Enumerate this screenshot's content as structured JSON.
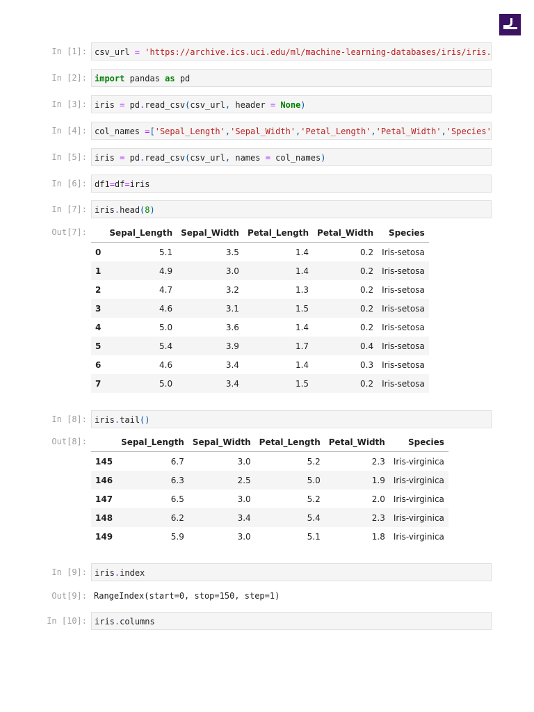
{
  "logo_text": "Jupyter",
  "cells": [
    {
      "prompt": "In [1]:",
      "tokens": [
        [
          "n",
          "csv_url "
        ],
        [
          "o",
          "="
        ],
        [
          "n",
          " "
        ],
        [
          "s",
          "'https://archive.ics.uci.edu/ml/machine-learning-databases/iris/iris.data'"
        ]
      ]
    },
    {
      "prompt": "In [2]:",
      "tokens": [
        [
          "k",
          "import"
        ],
        [
          "n",
          " pandas "
        ],
        [
          "k",
          "as"
        ],
        [
          "n",
          " pd"
        ]
      ]
    },
    {
      "prompt": "In [3]:",
      "tokens": [
        [
          "n",
          "iris "
        ],
        [
          "o",
          "="
        ],
        [
          "n",
          " pd"
        ],
        [
          "o",
          "."
        ],
        [
          "n",
          "read_csv"
        ],
        [
          "p",
          "("
        ],
        [
          "n",
          "csv_url"
        ],
        [
          "p",
          ","
        ],
        [
          "n",
          " header "
        ],
        [
          "o",
          "="
        ],
        [
          "n",
          " "
        ],
        [
          "k",
          "None"
        ],
        [
          "p",
          ")"
        ]
      ]
    },
    {
      "prompt": "In [4]:",
      "tokens": [
        [
          "n",
          "col_names "
        ],
        [
          "o",
          "="
        ],
        [
          "p",
          "["
        ],
        [
          "s",
          "'Sepal_Length'"
        ],
        [
          "p",
          ","
        ],
        [
          "s",
          "'Sepal_Width'"
        ],
        [
          "p",
          ","
        ],
        [
          "s",
          "'Petal_Length'"
        ],
        [
          "p",
          ","
        ],
        [
          "s",
          "'Petal_Width'"
        ],
        [
          "p",
          ","
        ],
        [
          "s",
          "'Species'"
        ],
        [
          "p",
          "]"
        ]
      ]
    },
    {
      "prompt": "In [5]:",
      "tokens": [
        [
          "n",
          "iris "
        ],
        [
          "o",
          "="
        ],
        [
          "n",
          " pd"
        ],
        [
          "o",
          "."
        ],
        [
          "n",
          "read_csv"
        ],
        [
          "p",
          "("
        ],
        [
          "n",
          "csv_url"
        ],
        [
          "p",
          ","
        ],
        [
          "n",
          " names "
        ],
        [
          "o",
          "="
        ],
        [
          "n",
          " col_names"
        ],
        [
          "p",
          ")"
        ]
      ]
    },
    {
      "prompt": "In [6]:",
      "tokens": [
        [
          "n",
          "df1"
        ],
        [
          "o",
          "="
        ],
        [
          "n",
          "df"
        ],
        [
          "o",
          "="
        ],
        [
          "n",
          "iris"
        ]
      ]
    },
    {
      "prompt": "In [7]:",
      "tokens": [
        [
          "n",
          "iris"
        ],
        [
          "o",
          "."
        ],
        [
          "n",
          "head"
        ],
        [
          "p",
          "("
        ],
        [
          "m",
          "8"
        ],
        [
          "p",
          ")"
        ]
      ]
    },
    {
      "prompt": "In [8]:",
      "tokens": [
        [
          "n",
          "iris"
        ],
        [
          "o",
          "."
        ],
        [
          "n",
          "tail"
        ],
        [
          "p",
          "()"
        ]
      ]
    },
    {
      "prompt": "In [9]:",
      "tokens": [
        [
          "n",
          "iris"
        ],
        [
          "o",
          "."
        ],
        [
          "n",
          "index"
        ]
      ]
    },
    {
      "prompt": "In [10]:",
      "tokens": [
        [
          "n",
          "iris"
        ],
        [
          "o",
          "."
        ],
        [
          "n",
          "columns"
        ]
      ]
    }
  ],
  "outputs": {
    "out7": {
      "prompt": "Out[7]:",
      "columns": [
        "",
        "Sepal_Length",
        "Sepal_Width",
        "Petal_Length",
        "Petal_Width",
        "Species"
      ],
      "rows": [
        [
          "0",
          "5.1",
          "3.5",
          "1.4",
          "0.2",
          "Iris-setosa"
        ],
        [
          "1",
          "4.9",
          "3.0",
          "1.4",
          "0.2",
          "Iris-setosa"
        ],
        [
          "2",
          "4.7",
          "3.2",
          "1.3",
          "0.2",
          "Iris-setosa"
        ],
        [
          "3",
          "4.6",
          "3.1",
          "1.5",
          "0.2",
          "Iris-setosa"
        ],
        [
          "4",
          "5.0",
          "3.6",
          "1.4",
          "0.2",
          "Iris-setosa"
        ],
        [
          "5",
          "5.4",
          "3.9",
          "1.7",
          "0.4",
          "Iris-setosa"
        ],
        [
          "6",
          "4.6",
          "3.4",
          "1.4",
          "0.3",
          "Iris-setosa"
        ],
        [
          "7",
          "5.0",
          "3.4",
          "1.5",
          "0.2",
          "Iris-setosa"
        ]
      ]
    },
    "out8": {
      "prompt": "Out[8]:",
      "columns": [
        "",
        "Sepal_Length",
        "Sepal_Width",
        "Petal_Length",
        "Petal_Width",
        "Species"
      ],
      "rows": [
        [
          "145",
          "6.7",
          "3.0",
          "5.2",
          "2.3",
          "Iris-virginica"
        ],
        [
          "146",
          "6.3",
          "2.5",
          "5.0",
          "1.9",
          "Iris-virginica"
        ],
        [
          "147",
          "6.5",
          "3.0",
          "5.2",
          "2.0",
          "Iris-virginica"
        ],
        [
          "148",
          "6.2",
          "3.4",
          "5.4",
          "2.3",
          "Iris-virginica"
        ],
        [
          "149",
          "5.9",
          "3.0",
          "5.1",
          "1.8",
          "Iris-virginica"
        ]
      ]
    },
    "out9": {
      "prompt": "Out[9]:",
      "text": "RangeIndex(start=0, stop=150, step=1)"
    }
  }
}
